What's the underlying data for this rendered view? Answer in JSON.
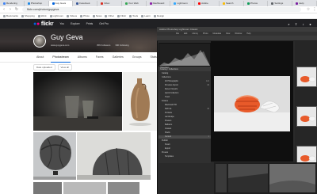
{
  "browser": {
    "tabs": [
      {
        "label": "Rendering",
        "color": "#4285f4"
      },
      {
        "label": "Photoshop",
        "color": "#1e88e5"
      },
      {
        "label": "Guy Geva",
        "color": "#0063dc"
      },
      {
        "label": "Facebook",
        "color": "#3b5998"
      },
      {
        "label": "Inbox",
        "color": "#d93025"
      },
      {
        "label": "Your Web",
        "color": "#34a853"
      },
      {
        "label": "Dashboard",
        "color": "#8e24aa"
      },
      {
        "label": "Lightroom",
        "color": "#31a8ff"
      },
      {
        "label": "Adobe",
        "color": "#ff0000"
      },
      {
        "label": "Search",
        "color": "#fbbc05"
      },
      {
        "label": "Photos",
        "color": "#0f9d58"
      },
      {
        "label": "Settings",
        "color": "#5f6368"
      },
      {
        "label": "Help",
        "color": "#7b1fa2"
      }
    ],
    "url": "flickr.com/photos/guygeva",
    "bookmarks": [
      "Bookmarks",
      "Shopping",
      "Work",
      "Lightroom",
      "Videos",
      "Photo",
      "News",
      "Other",
      "Flickr",
      "Tools",
      "Learn",
      "Design"
    ]
  },
  "flickr": {
    "logo": "flickr",
    "nav": [
      "You",
      "Explore",
      "Prints",
      "Get Pro"
    ],
    "icons": [
      "search-icon",
      "upload-icon",
      "bell-icon",
      "avatar-icon"
    ]
  },
  "profile": {
    "name": "Guy Geva",
    "subtitle": "www.guygeva.com",
    "stats": [
      "356 Followers",
      "390 Following"
    ]
  },
  "subtabs": [
    "About",
    "Photostream",
    "Albums",
    "Faves",
    "Galleries",
    "Groups",
    "Stats"
  ],
  "filters": {
    "date": "Date uploaded",
    "view": "View all"
  },
  "photoshop": {
    "title": "Adobe Photoshop Lightroom Classic",
    "menu": [
      "File",
      "Edit",
      "Library",
      "Photo",
      "Metadata",
      "View",
      "Window",
      "Help"
    ],
    "panels": {
      "histogram": "Histogram",
      "catalog": "Catalog / Collections"
    },
    "rows": [
      {
        "label": "Catalog",
        "count": "",
        "sel": false,
        "sub": false
      },
      {
        "label": "Collections",
        "count": "",
        "sel": false,
        "sub": false
      },
      {
        "label": "All Photographs",
        "count": "121",
        "sel": false,
        "sub": true
      },
      {
        "label": "Previous Import",
        "count": "29",
        "sel": false,
        "sub": true
      },
      {
        "label": "Recent Imports",
        "count": "",
        "sel": false,
        "sub": true
      },
      {
        "label": "Quick Collection",
        "count": "",
        "sel": false,
        "sub": true
      },
      {
        "label": "Trash",
        "count": "",
        "sel": false,
        "sub": true
      },
      {
        "label": "Folders",
        "count": "",
        "sel": false,
        "sub": false
      },
      {
        "label": "Macintosh HD",
        "count": "",
        "sel": false,
        "sub": true
      },
      {
        "label": "Still Life",
        "count": "40",
        "sel": false,
        "sub": true
      },
      {
        "label": "Portraits",
        "count": "",
        "sel": false,
        "sub": true
      },
      {
        "label": "Landscape",
        "count": "",
        "sel": false,
        "sub": true
      },
      {
        "label": "Flowers",
        "count": "",
        "sel": false,
        "sub": true
      },
      {
        "label": "Balloons",
        "count": "",
        "sel": false,
        "sub": true
      },
      {
        "label": "Vessels",
        "count": "",
        "sel": false,
        "sub": true
      },
      {
        "label": "Shells",
        "count": "",
        "sel": false,
        "sub": true
      },
      {
        "label": "Current",
        "count": "1",
        "sel": true,
        "sub": true
      },
      {
        "label": "Publish",
        "count": "",
        "sel": false,
        "sub": false
      },
      {
        "label": "Smart",
        "count": "",
        "sel": false,
        "sub": true
      },
      {
        "label": "Export",
        "count": "",
        "sel": false,
        "sub": true
      },
      {
        "label": "Presets",
        "count": "",
        "sel": false,
        "sub": false
      },
      {
        "label": "Templates",
        "count": "",
        "sel": false,
        "sub": true
      }
    ]
  },
  "colors": {
    "flickr_blue": "#0063dc",
    "flickr_pink": "#ff0084",
    "dark_bg": "#212124"
  }
}
